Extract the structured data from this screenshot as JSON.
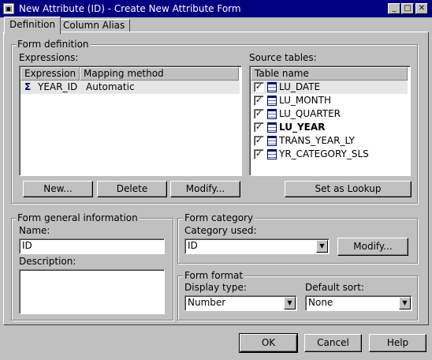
{
  "window": {
    "title": "New Attribute (ID) - Create New Attribute Form",
    "controls": [
      "minimize-icon",
      "maximize-icon",
      "close-icon"
    ]
  },
  "tabs": [
    {
      "label": "Definition",
      "active": true
    },
    {
      "label": "Column Alias",
      "active": false
    }
  ],
  "form_definition": {
    "group_label": "Form definition",
    "expressions_label": "Expressions:",
    "columns": [
      "Expression",
      "Mapping method"
    ],
    "rows": [
      {
        "expression": "YEAR_ID",
        "mapping": "Automatic"
      }
    ],
    "buttons": {
      "new": "New...",
      "delete": "Delete",
      "modify": "Modify..."
    }
  },
  "source_tables": {
    "label": "Source tables:",
    "column": "Table name",
    "items": [
      {
        "name": "LU_DATE",
        "checked": true,
        "bold": false,
        "selected": true
      },
      {
        "name": "LU_MONTH",
        "checked": true,
        "bold": false
      },
      {
        "name": "LU_QUARTER",
        "checked": true,
        "bold": false
      },
      {
        "name": "LU_YEAR",
        "checked": true,
        "bold": true
      },
      {
        "name": "TRANS_YEAR_LY",
        "checked": true,
        "bold": false
      },
      {
        "name": "YR_CATEGORY_SLS",
        "checked": true,
        "bold": false
      }
    ],
    "lookup_button": "Set as Lookup"
  },
  "general_info": {
    "group_label": "Form general information",
    "name_label": "Name:",
    "name_value": "ID",
    "description_label": "Description:",
    "description_value": ""
  },
  "category": {
    "group_label": "Form category",
    "label": "Category used:",
    "value": "ID",
    "modify_button": "Modify..."
  },
  "format": {
    "group_label": "Form format",
    "display_label": "Display type:",
    "display_value": "Number",
    "sort_label": "Default sort:",
    "sort_value": "None"
  },
  "footer": {
    "ok": "OK",
    "cancel": "Cancel",
    "help": "Help"
  }
}
